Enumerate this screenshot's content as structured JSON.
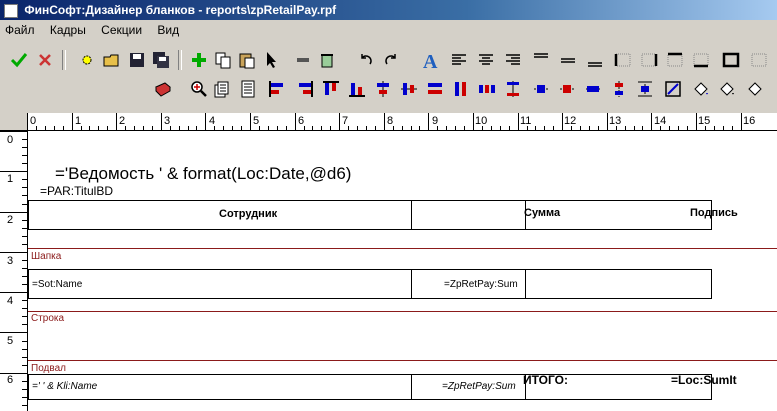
{
  "window": {
    "title": "ФинСофт:Дизайнер бланков - reports\\zpRetailPay.rpf"
  },
  "menu": [
    "Файл",
    "Кадры",
    "Секции",
    "Вид"
  ],
  "toolbar1": [
    {
      "name": "apply-check-icon"
    },
    {
      "name": "cancel-x-icon"
    },
    {
      "name": "new-icon"
    },
    {
      "name": "open-icon"
    },
    {
      "name": "save-icon"
    },
    {
      "name": "save-all-icon"
    },
    {
      "name": "add-plus-icon"
    },
    {
      "name": "copy-icon"
    },
    {
      "name": "paste-icon"
    },
    {
      "name": "pointer-icon"
    },
    {
      "name": "minus-icon"
    },
    {
      "name": "clear-icon"
    },
    {
      "name": "undo-icon"
    },
    {
      "name": "redo-icon"
    },
    {
      "name": "font-a-icon"
    },
    {
      "name": "align-left-icon"
    },
    {
      "name": "align-center-icon"
    },
    {
      "name": "align-right-icon"
    },
    {
      "name": "valign-top-icon"
    },
    {
      "name": "valign-middle-icon"
    },
    {
      "name": "valign-bottom-icon"
    },
    {
      "name": "border-left-icon"
    },
    {
      "name": "border-right-icon"
    },
    {
      "name": "border-top-icon"
    },
    {
      "name": "border-bottom-icon"
    },
    {
      "name": "border-box-icon"
    },
    {
      "name": "border-none-icon"
    }
  ],
  "toolbar2": [
    {
      "name": "book-icon"
    },
    {
      "name": "zoom-icon"
    },
    {
      "name": "pages-icon"
    },
    {
      "name": "page-setup-icon"
    },
    {
      "name": "align-lefts-icon"
    },
    {
      "name": "align-rights-icon"
    },
    {
      "name": "align-tops-icon"
    },
    {
      "name": "align-bottoms-icon"
    },
    {
      "name": "center-h-icon"
    },
    {
      "name": "center-v-icon"
    },
    {
      "name": "same-width-icon"
    },
    {
      "name": "same-height-icon"
    },
    {
      "name": "space-h-icon"
    },
    {
      "name": "space-v-icon"
    },
    {
      "name": "move-left-icon"
    },
    {
      "name": "move-right-icon"
    },
    {
      "name": "move-up-icon"
    },
    {
      "name": "move-down-icon"
    },
    {
      "name": "resize-icon"
    },
    {
      "name": "fill-icon"
    },
    {
      "name": "fill-color-icon"
    }
  ],
  "ruler": {
    "h": [
      "0",
      "1",
      "2",
      "3",
      "4",
      "5",
      "6",
      "7",
      "8",
      "9",
      "10",
      "11",
      "12",
      "13",
      "14",
      "15",
      "16"
    ],
    "v": [
      "0",
      "1",
      "2",
      "3",
      "4",
      "5",
      "6"
    ]
  },
  "report": {
    "title_expr": "='Ведомость      ' &  format(Loc:Date,@d6)",
    "subtitle_expr": "=PAR:TitulBD",
    "header": {
      "col1": "Сотрудник",
      "col2": "Сумма",
      "col3": "Подпись"
    },
    "band_header": "Шапка",
    "row": {
      "col1": "=Sot:Name",
      "col2": "=ZpRetPay:Sum"
    },
    "band_row": "Строка",
    "band_footer": "Подвал",
    "footer": {
      "col1": "='               ' & Kli:Name",
      "col2": "=ZpRetPay:Sum",
      "total_label": "ИТОГО:",
      "total_expr": "=Loc:SumIt"
    }
  }
}
